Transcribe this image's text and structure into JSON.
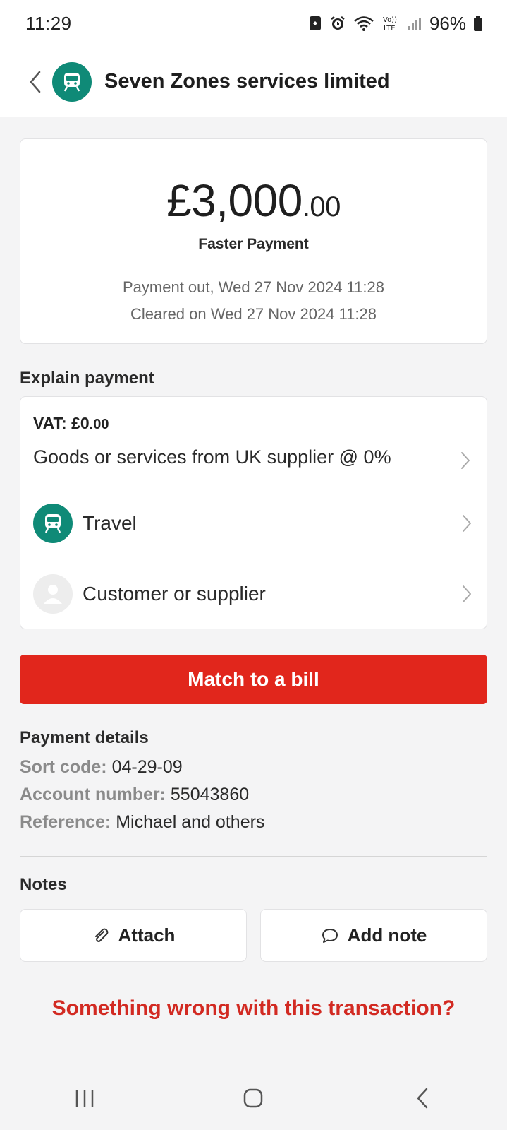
{
  "status_bar": {
    "time": "11:29",
    "battery_percent": "96%",
    "icons": [
      "lock-icon",
      "alarm-icon",
      "wifi-icon",
      "volte-icon",
      "signal-icon",
      "battery-icon"
    ]
  },
  "header": {
    "title": "Seven Zones services limited",
    "avatar_icon": "train-icon",
    "accent_color": "#0f8a77"
  },
  "transaction": {
    "amount_main": "£3,000",
    "amount_pence": ".00",
    "payment_type": "Faster Payment",
    "payment_out": "Payment out, Wed 27 Nov 2024 11:28",
    "cleared": "Cleared on Wed 27 Nov 2024 11:28"
  },
  "explain": {
    "section_title": "Explain payment",
    "vat_label": "VAT: £0",
    "vat_pence": ".00",
    "vat_rate": "Goods or services from UK supplier @ 0%",
    "category": "Travel",
    "contact": "Customer or supplier"
  },
  "match_button": {
    "label": "Match to a bill",
    "color": "#e1261c"
  },
  "payment_details": {
    "section_title": "Payment details",
    "sort_code_label": "Sort code:",
    "sort_code": "04-29-09",
    "account_number_label": "Account number:",
    "account_number": "55043860",
    "reference_label": "Reference:",
    "reference": "Michael and others"
  },
  "notes": {
    "section_title": "Notes",
    "attach_label": "Attach",
    "add_note_label": "Add note"
  },
  "problem_link": "Something wrong with this transaction?"
}
